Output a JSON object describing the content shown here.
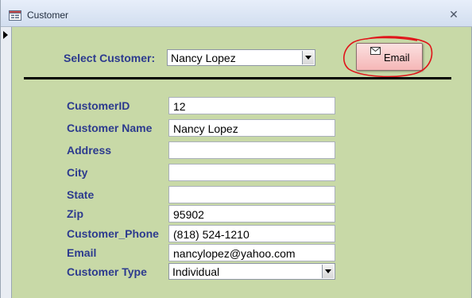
{
  "window": {
    "title": "Customer",
    "close_glyph": "✕"
  },
  "header": {
    "select_customer_label": "Select Customer:",
    "select_customer_value": "Nancy Lopez"
  },
  "email_button": {
    "label": "Email",
    "icon": "email-icon"
  },
  "fields": [
    {
      "label": "CustomerID",
      "value": "12"
    },
    {
      "label": "Customer Name",
      "value": "Nancy Lopez"
    },
    {
      "label": "Address",
      "value": ""
    },
    {
      "label": "City",
      "value": ""
    },
    {
      "label": "State",
      "value": ""
    },
    {
      "label": "Zip",
      "value": "95902"
    },
    {
      "label": "Customer_Phone",
      "value": "(818) 524-1210"
    },
    {
      "label": "Email",
      "value": "nancylopez@yahoo.com"
    },
    {
      "label": "Customer Type",
      "value": "Individual"
    }
  ],
  "colors": {
    "form_background": "#c8d9a7",
    "label_color": "#2c3a8e",
    "button_background": "#f5b7b7",
    "annotation_circle": "#e0141a"
  }
}
